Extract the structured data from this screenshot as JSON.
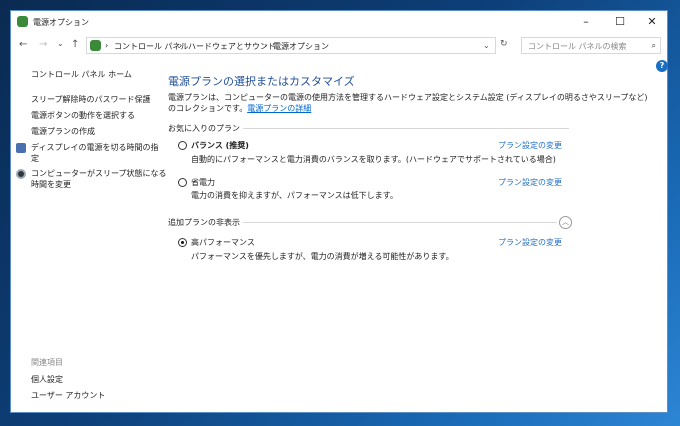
{
  "window": {
    "title": "電源オプション",
    "minimize": "–",
    "maximize": "☐",
    "close": "✕"
  },
  "address": {
    "back": "←",
    "forward": "→",
    "recent": "⌄",
    "up": "↑",
    "crumbs": [
      "コントロール パネル",
      "ハードウェアとサウンド",
      "電源オプション"
    ],
    "sep": "›",
    "dropdown": "⌄",
    "refresh": "↻",
    "search_placeholder": "コントロール パネルの検索",
    "search_icon": "⌕"
  },
  "sidebar": {
    "home": "コントロール パネル ホーム",
    "links": [
      "スリープ解除時のパスワード保護",
      "電源ボタンの動作を選択する",
      "電源プランの作成"
    ],
    "display_l1": "ディスプレイの電源を切る時間の指",
    "display_l2": "定",
    "sleep_l1": "コンピューターがスリープ状態になる",
    "sleep_l2": "時間を変更",
    "related_heading": "関連項目",
    "related": [
      "個人設定",
      "ユーザー アカウント"
    ]
  },
  "main": {
    "title": "電源プランの選択またはカスタマイズ",
    "desc_l1": "電源プランは、コンピューターの電源の使用方法を管理するハードウェア設定とシステム設定 (ディスプレイの明るさやスリープなど)",
    "desc_l2": "のコレクションです。",
    "desc_link": "電源プランの詳細",
    "favorites_heading": "お気に入りのプラン",
    "hidden_heading": "追加プランの非表示",
    "help": "?",
    "collapse": "︿",
    "plans": [
      {
        "name": "バランス (推奨)",
        "desc": "自動的にパフォーマンスと電力消費のバランスを取ります。(ハードウェアでサポートされている場合)",
        "change": "プラン設定の変更",
        "selected": false
      },
      {
        "name": "省電力",
        "desc": "電力の消費を抑えますが、パフォーマンスは低下します。",
        "change": "プラン設定の変更",
        "selected": false
      },
      {
        "name": "高パフォーマンス",
        "desc": "パフォーマンスを優先しますが、電力の消費が増える可能性があります。",
        "change": "プラン設定の変更",
        "selected": true
      }
    ]
  }
}
